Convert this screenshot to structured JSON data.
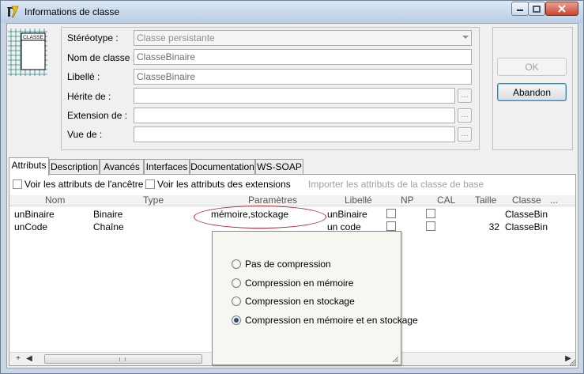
{
  "window": {
    "title": "Informations de classe",
    "buttons": {
      "minimize": "–",
      "maximize": "□",
      "close": "✕"
    }
  },
  "class_icon": {
    "label": "CLASSE"
  },
  "form": {
    "stereotype_label": "Stéréotype :",
    "stereotype_value": "Classe persistante",
    "name_label": "Nom de classe :",
    "name_value": "ClasseBinaire",
    "libelle_label": "Libellé :",
    "libelle_value": "ClasseBinaire",
    "herite_label": "Hérite de :",
    "herite_value": "",
    "extension_label": "Extension de :",
    "extension_value": "",
    "vue_label": "Vue de :",
    "vue_value": "",
    "browse_label": "..."
  },
  "actions": {
    "ok": "OK",
    "abandon": "Abandon"
  },
  "tabs": [
    "Attributs",
    "Description",
    "Avancés",
    "Interfaces",
    "Documentation",
    "WS-SOAP"
  ],
  "options": {
    "show_ancestor": "Voir les attributs de l'ancêtre",
    "show_extensions": "Voir les attributs des extensions",
    "import_base": "Importer les attributs de la classe de base"
  },
  "grid": {
    "columns": [
      "Nom",
      "Type",
      "Paramètres",
      "Libellé",
      "NP",
      "CAL",
      "Taille",
      "Classe",
      "..."
    ],
    "rows": [
      {
        "nom": "unBinaire",
        "type": "Binaire",
        "parametres": "mémoire,stockage",
        "libelle": "unBinaire",
        "taille": "",
        "classe": "ClasseBin"
      },
      {
        "nom": "unCode",
        "type": "Chaîne",
        "parametres": "",
        "libelle": "un code",
        "taille": "32",
        "classe": "ClasseBin"
      }
    ]
  },
  "popup": {
    "options": [
      "Pas de compression",
      "Compression en mémoire",
      "Compression en stockage",
      "Compression en mémoire et en stockage"
    ],
    "selected_index": 3
  },
  "scrollbar": {
    "plus": "+",
    "left": "◀",
    "right": "▶"
  },
  "colors": {
    "highlight_ellipse": "#c0202a",
    "radio_selected": "#2d4f7c"
  }
}
